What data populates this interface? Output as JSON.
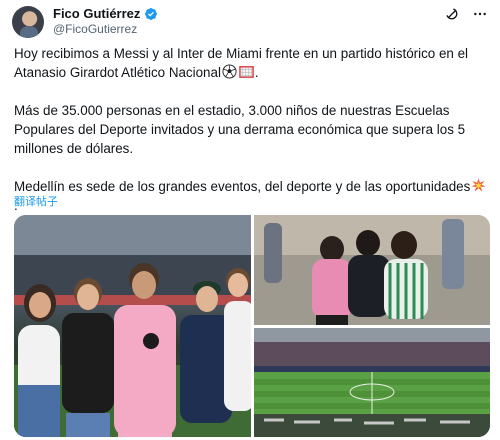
{
  "author": {
    "name": "Fico Gutiérrez",
    "handle": "@FicoGutierrez",
    "verified": true,
    "accent_color": "#1d9bf0"
  },
  "header_icons": [
    "grok-icon",
    "more-options-icon"
  ],
  "tweet": {
    "paragraph_1": "Hoy recibimos a Messi y al Inter de Miami frente en un partido histórico en el Atanasio Girardot Atlético Nacional",
    "paragraph_1_end": ".",
    "paragraph_2": "Más de 35.000 personas en el estadio, 3.000 niños de nuestras Escuelas Populares del Deporte invitados y una derrama económica que supera los 5 millones de dólares.",
    "paragraph_3": "Medellín es sede de los grandes eventos, del deporte y de las oportunidades",
    "paragraph_3_end": ".",
    "emojis": [
      "soccer-ball-emoji",
      "goal-net-emoji",
      "collision-emoji"
    ]
  },
  "translate_label": "翻译帖子",
  "media": {
    "count": 3,
    "images": [
      "group-photo-with-messi",
      "children-hugging",
      "stadium-view"
    ]
  }
}
